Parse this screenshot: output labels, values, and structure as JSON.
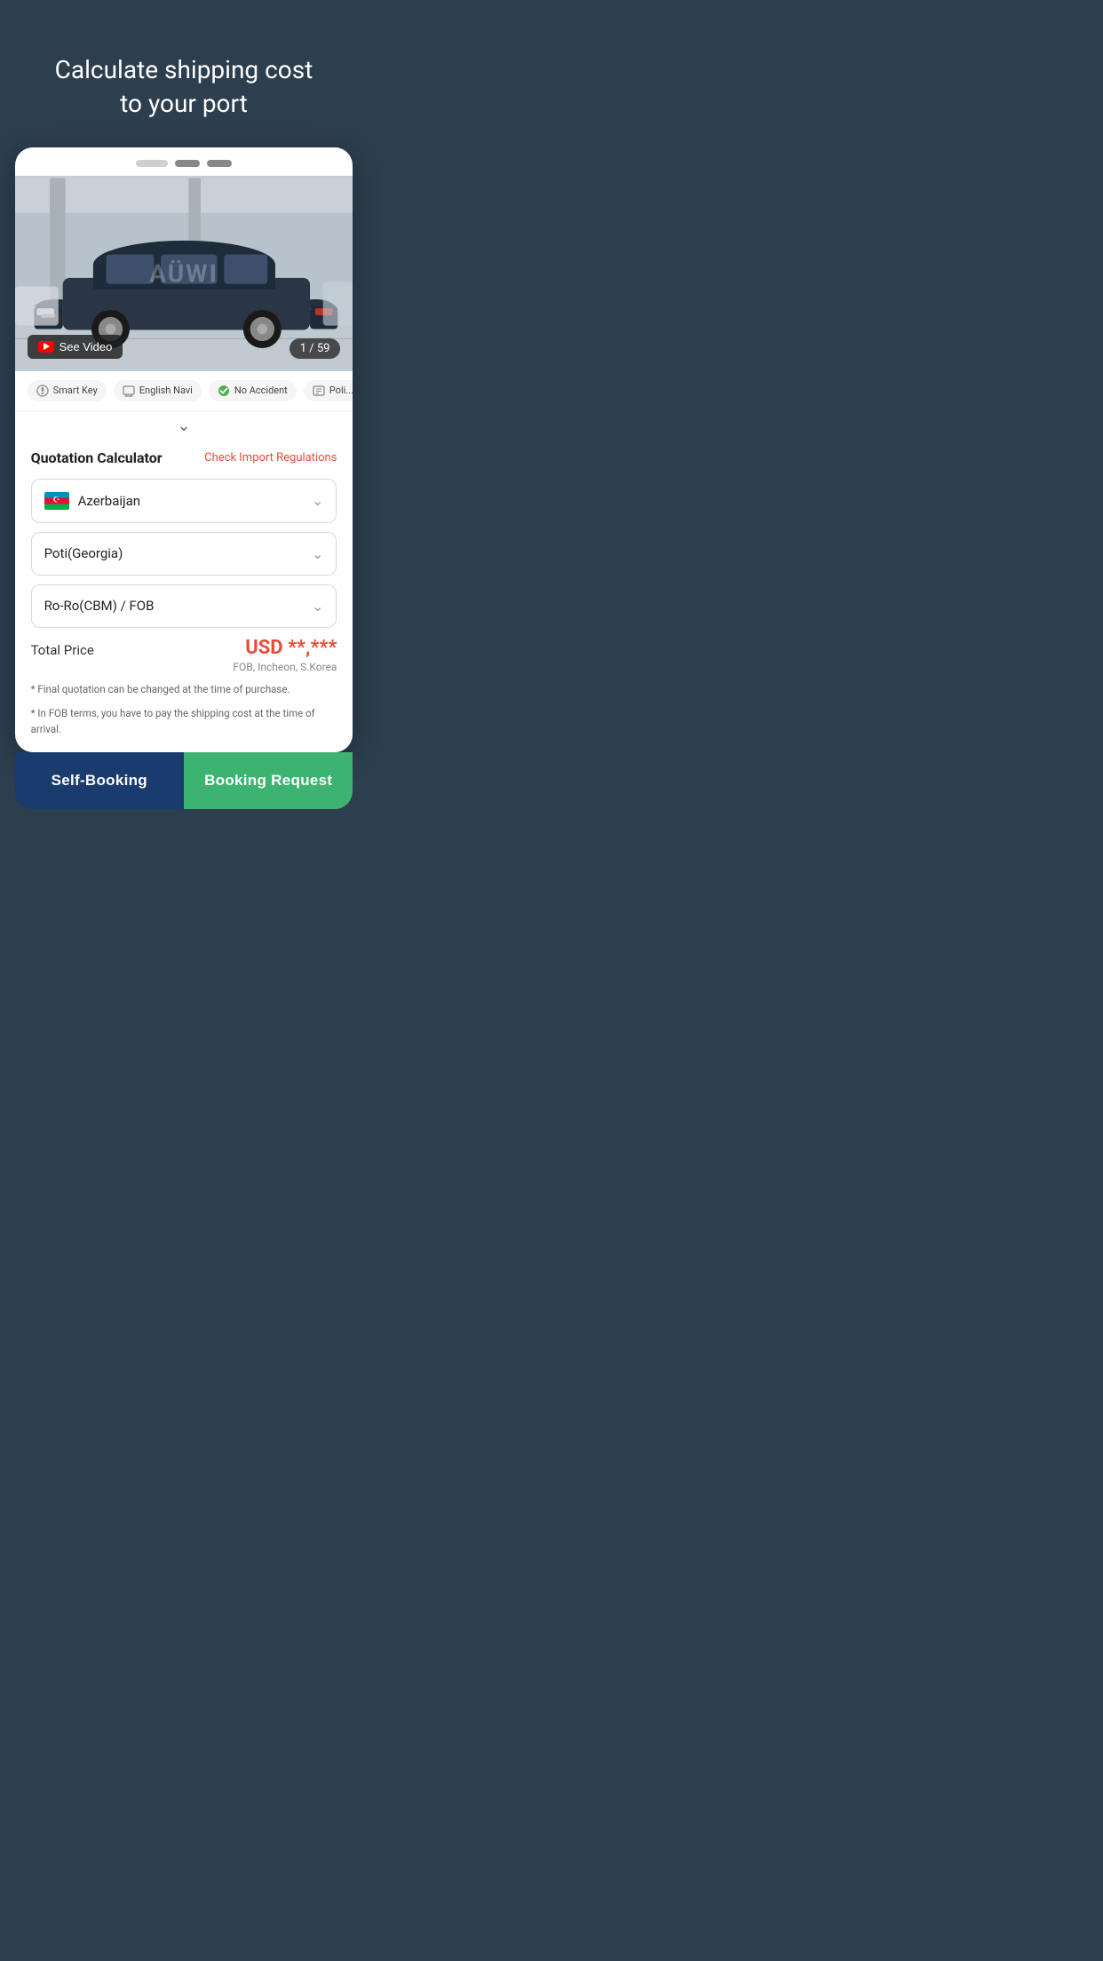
{
  "page": {
    "header": {
      "title": "Calculate shipping cost\nto your port"
    },
    "background_color": "#2d3e4e"
  },
  "carousel": {
    "photo_count": "1 / 59",
    "dots": [
      "inactive",
      "active",
      "active"
    ]
  },
  "video_button": {
    "label": "See Video"
  },
  "feature_tags": [
    {
      "label": "Smart Key",
      "icon_color": "#999"
    },
    {
      "label": "English Navi",
      "icon_color": "#999"
    },
    {
      "label": "No Accident",
      "icon_color": "#4caf50"
    },
    {
      "label": "Poli...",
      "icon_color": "#999"
    }
  ],
  "quotation": {
    "title": "Quotation Calculator",
    "check_import_label": "Check Import Regulations",
    "country_field": {
      "value": "Azerbaijan",
      "has_flag": true
    },
    "port_field": {
      "value": "Poti(Georgia)"
    },
    "shipping_field": {
      "value": "Ro-Ro(CBM) / FOB"
    },
    "total_price_label": "Total Price",
    "price_display": "USD  **,***",
    "price_location": "FOB, Incheon, S.Korea",
    "disclaimer_1": "* Final quotation can be changed at the time of purchase.",
    "disclaimer_2": "* In FOB terms, you have to pay the shipping cost at the time of arrival."
  },
  "buttons": {
    "self_booking": "Self-Booking",
    "booking_request": "Booking Request"
  },
  "watermark": "AÜWI"
}
